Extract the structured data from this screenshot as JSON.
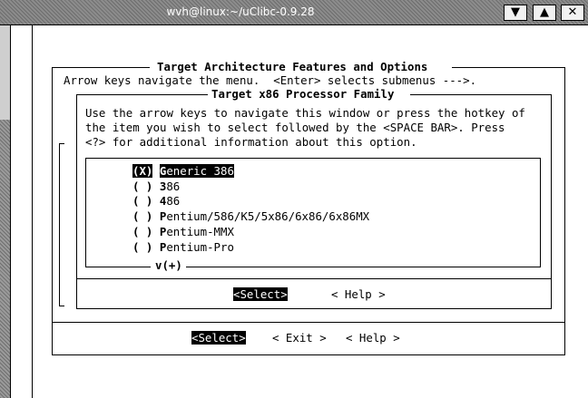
{
  "window": {
    "title": "wvh@linux:~/uClibc-0.9.28",
    "buttons": {
      "menu": "▼",
      "maximize": "▲",
      "close": "✕"
    }
  },
  "outer": {
    "title": "Target Architecture Features and Options",
    "help_line": "Arrow keys navigate the menu.  <Enter> selects submenus --->."
  },
  "dialog": {
    "title": "Target x86 Processor Family",
    "instructions": [
      "Use the arrow keys to navigate this window or press the hotkey of",
      "the item you wish to select followed by the <SPACE BAR>. Press",
      "<?> for additional information about this option."
    ],
    "options": [
      {
        "mark": "(X)",
        "hotkey": "G",
        "rest": "eneric 386"
      },
      {
        "mark": "( )",
        "hotkey": "3",
        "rest": "86"
      },
      {
        "mark": "( )",
        "hotkey": "4",
        "rest": "86"
      },
      {
        "mark": "( )",
        "hotkey": "P",
        "rest": "entium/586/K5/5x86/6x86/6x86MX"
      },
      {
        "mark": "( )",
        "hotkey": "P",
        "rest": "entium-MMX"
      },
      {
        "mark": "( )",
        "hotkey": "P",
        "rest": "entium-Pro"
      }
    ],
    "more_indicator": "v(+)",
    "select_label": "<Select>",
    "help_label": "< Help >"
  },
  "bottom_buttons": {
    "select": "<Select>",
    "exit": "< Exit >",
    "help": "< Help >"
  }
}
